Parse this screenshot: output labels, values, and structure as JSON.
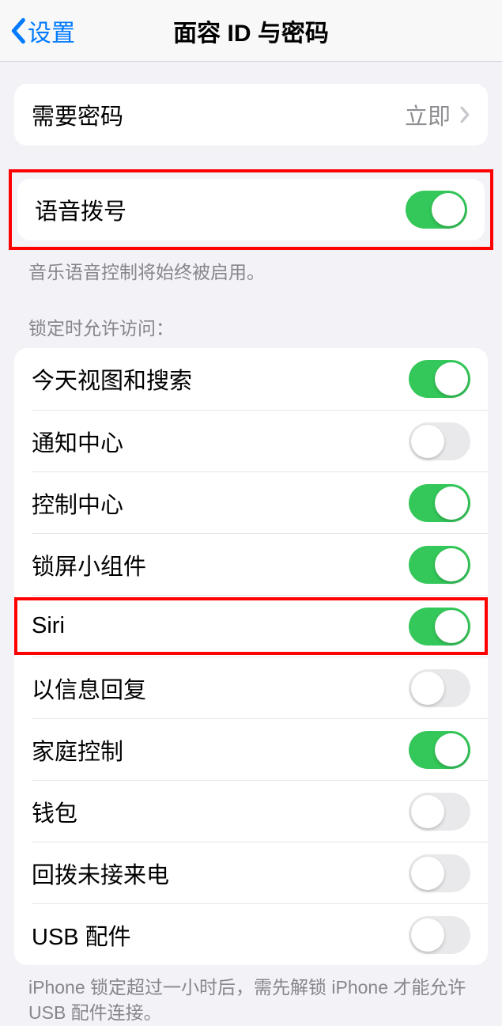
{
  "nav": {
    "back_label": "设置",
    "title": "面容 ID 与密码"
  },
  "require_passcode": {
    "label": "需要密码",
    "value": "立即"
  },
  "voice_dial": {
    "label": "语音拨号",
    "on": true,
    "footer": "音乐语音控制将始终被启用。"
  },
  "lock_access": {
    "header": "锁定时允许访问：",
    "items": [
      {
        "label": "今天视图和搜索",
        "on": true
      },
      {
        "label": "通知中心",
        "on": false
      },
      {
        "label": "控制中心",
        "on": true
      },
      {
        "label": "锁屏小组件",
        "on": true
      },
      {
        "label": "Siri",
        "on": true,
        "highlight": true
      },
      {
        "label": "以信息回复",
        "on": false
      },
      {
        "label": "家庭控制",
        "on": true
      },
      {
        "label": "钱包",
        "on": false
      },
      {
        "label": "回拨未接来电",
        "on": false
      },
      {
        "label": "USB 配件",
        "on": false
      }
    ],
    "footer": "iPhone 锁定超过一小时后，需先解锁 iPhone 才能允许 USB 配件连接。"
  }
}
